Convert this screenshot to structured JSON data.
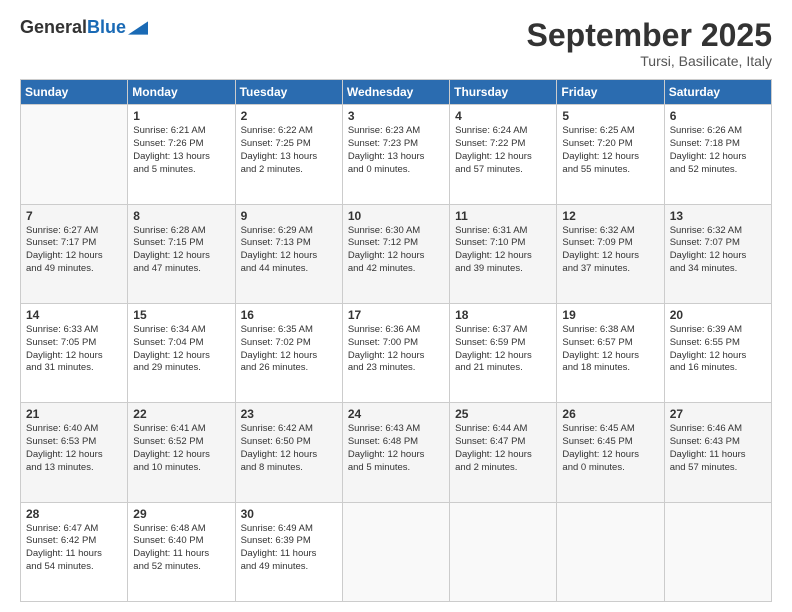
{
  "header": {
    "logo_general": "General",
    "logo_blue": "Blue",
    "month": "September 2025",
    "location": "Tursi, Basilicate, Italy"
  },
  "weekdays": [
    "Sunday",
    "Monday",
    "Tuesday",
    "Wednesday",
    "Thursday",
    "Friday",
    "Saturday"
  ],
  "weeks": [
    [
      {
        "day": "",
        "info": ""
      },
      {
        "day": "1",
        "info": "Sunrise: 6:21 AM\nSunset: 7:26 PM\nDaylight: 13 hours\nand 5 minutes."
      },
      {
        "day": "2",
        "info": "Sunrise: 6:22 AM\nSunset: 7:25 PM\nDaylight: 13 hours\nand 2 minutes."
      },
      {
        "day": "3",
        "info": "Sunrise: 6:23 AM\nSunset: 7:23 PM\nDaylight: 13 hours\nand 0 minutes."
      },
      {
        "day": "4",
        "info": "Sunrise: 6:24 AM\nSunset: 7:22 PM\nDaylight: 12 hours\nand 57 minutes."
      },
      {
        "day": "5",
        "info": "Sunrise: 6:25 AM\nSunset: 7:20 PM\nDaylight: 12 hours\nand 55 minutes."
      },
      {
        "day": "6",
        "info": "Sunrise: 6:26 AM\nSunset: 7:18 PM\nDaylight: 12 hours\nand 52 minutes."
      }
    ],
    [
      {
        "day": "7",
        "info": "Sunrise: 6:27 AM\nSunset: 7:17 PM\nDaylight: 12 hours\nand 49 minutes."
      },
      {
        "day": "8",
        "info": "Sunrise: 6:28 AM\nSunset: 7:15 PM\nDaylight: 12 hours\nand 47 minutes."
      },
      {
        "day": "9",
        "info": "Sunrise: 6:29 AM\nSunset: 7:13 PM\nDaylight: 12 hours\nand 44 minutes."
      },
      {
        "day": "10",
        "info": "Sunrise: 6:30 AM\nSunset: 7:12 PM\nDaylight: 12 hours\nand 42 minutes."
      },
      {
        "day": "11",
        "info": "Sunrise: 6:31 AM\nSunset: 7:10 PM\nDaylight: 12 hours\nand 39 minutes."
      },
      {
        "day": "12",
        "info": "Sunrise: 6:32 AM\nSunset: 7:09 PM\nDaylight: 12 hours\nand 37 minutes."
      },
      {
        "day": "13",
        "info": "Sunrise: 6:32 AM\nSunset: 7:07 PM\nDaylight: 12 hours\nand 34 minutes."
      }
    ],
    [
      {
        "day": "14",
        "info": "Sunrise: 6:33 AM\nSunset: 7:05 PM\nDaylight: 12 hours\nand 31 minutes."
      },
      {
        "day": "15",
        "info": "Sunrise: 6:34 AM\nSunset: 7:04 PM\nDaylight: 12 hours\nand 29 minutes."
      },
      {
        "day": "16",
        "info": "Sunrise: 6:35 AM\nSunset: 7:02 PM\nDaylight: 12 hours\nand 26 minutes."
      },
      {
        "day": "17",
        "info": "Sunrise: 6:36 AM\nSunset: 7:00 PM\nDaylight: 12 hours\nand 23 minutes."
      },
      {
        "day": "18",
        "info": "Sunrise: 6:37 AM\nSunset: 6:59 PM\nDaylight: 12 hours\nand 21 minutes."
      },
      {
        "day": "19",
        "info": "Sunrise: 6:38 AM\nSunset: 6:57 PM\nDaylight: 12 hours\nand 18 minutes."
      },
      {
        "day": "20",
        "info": "Sunrise: 6:39 AM\nSunset: 6:55 PM\nDaylight: 12 hours\nand 16 minutes."
      }
    ],
    [
      {
        "day": "21",
        "info": "Sunrise: 6:40 AM\nSunset: 6:53 PM\nDaylight: 12 hours\nand 13 minutes."
      },
      {
        "day": "22",
        "info": "Sunrise: 6:41 AM\nSunset: 6:52 PM\nDaylight: 12 hours\nand 10 minutes."
      },
      {
        "day": "23",
        "info": "Sunrise: 6:42 AM\nSunset: 6:50 PM\nDaylight: 12 hours\nand 8 minutes."
      },
      {
        "day": "24",
        "info": "Sunrise: 6:43 AM\nSunset: 6:48 PM\nDaylight: 12 hours\nand 5 minutes."
      },
      {
        "day": "25",
        "info": "Sunrise: 6:44 AM\nSunset: 6:47 PM\nDaylight: 12 hours\nand 2 minutes."
      },
      {
        "day": "26",
        "info": "Sunrise: 6:45 AM\nSunset: 6:45 PM\nDaylight: 12 hours\nand 0 minutes."
      },
      {
        "day": "27",
        "info": "Sunrise: 6:46 AM\nSunset: 6:43 PM\nDaylight: 11 hours\nand 57 minutes."
      }
    ],
    [
      {
        "day": "28",
        "info": "Sunrise: 6:47 AM\nSunset: 6:42 PM\nDaylight: 11 hours\nand 54 minutes."
      },
      {
        "day": "29",
        "info": "Sunrise: 6:48 AM\nSunset: 6:40 PM\nDaylight: 11 hours\nand 52 minutes."
      },
      {
        "day": "30",
        "info": "Sunrise: 6:49 AM\nSunset: 6:39 PM\nDaylight: 11 hours\nand 49 minutes."
      },
      {
        "day": "",
        "info": ""
      },
      {
        "day": "",
        "info": ""
      },
      {
        "day": "",
        "info": ""
      },
      {
        "day": "",
        "info": ""
      }
    ]
  ]
}
